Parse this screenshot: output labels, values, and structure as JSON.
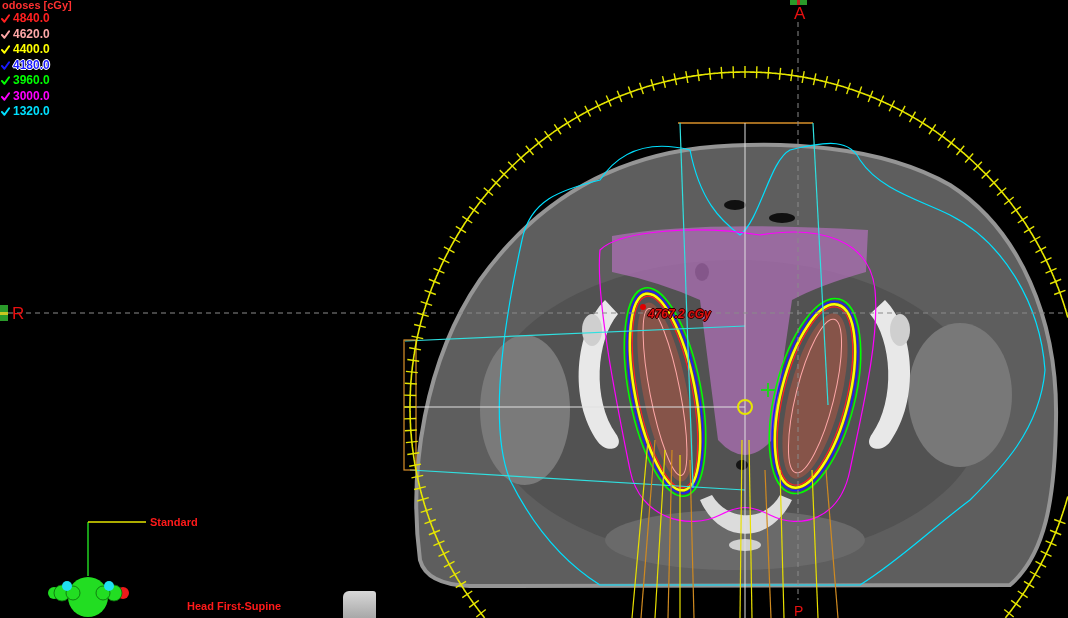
{
  "isodose_legend": {
    "title": "odoses [cGy]",
    "levels": [
      {
        "value": "4840.0",
        "color": "#ff2020",
        "checked": true
      },
      {
        "value": "4620.0",
        "color": "#ffa8a8",
        "checked": true
      },
      {
        "value": "4400.0",
        "color": "#ffff00",
        "checked": true
      },
      {
        "value": "4180.0",
        "color": "#1a1aff",
        "checked": true
      },
      {
        "value": "3960.0",
        "color": "#00ff00",
        "checked": true
      },
      {
        "value": "3000.0",
        "color": "#ff00ff",
        "checked": true
      },
      {
        "value": "1320.0",
        "color": "#00e0ff",
        "checked": true
      }
    ]
  },
  "orientation_labels": {
    "top": "A",
    "left": "R",
    "bottom": "P"
  },
  "dose_readout": "4767.2 cGy",
  "patient_orientation": {
    "view": "Standard",
    "position": "Head First-Supine"
  }
}
